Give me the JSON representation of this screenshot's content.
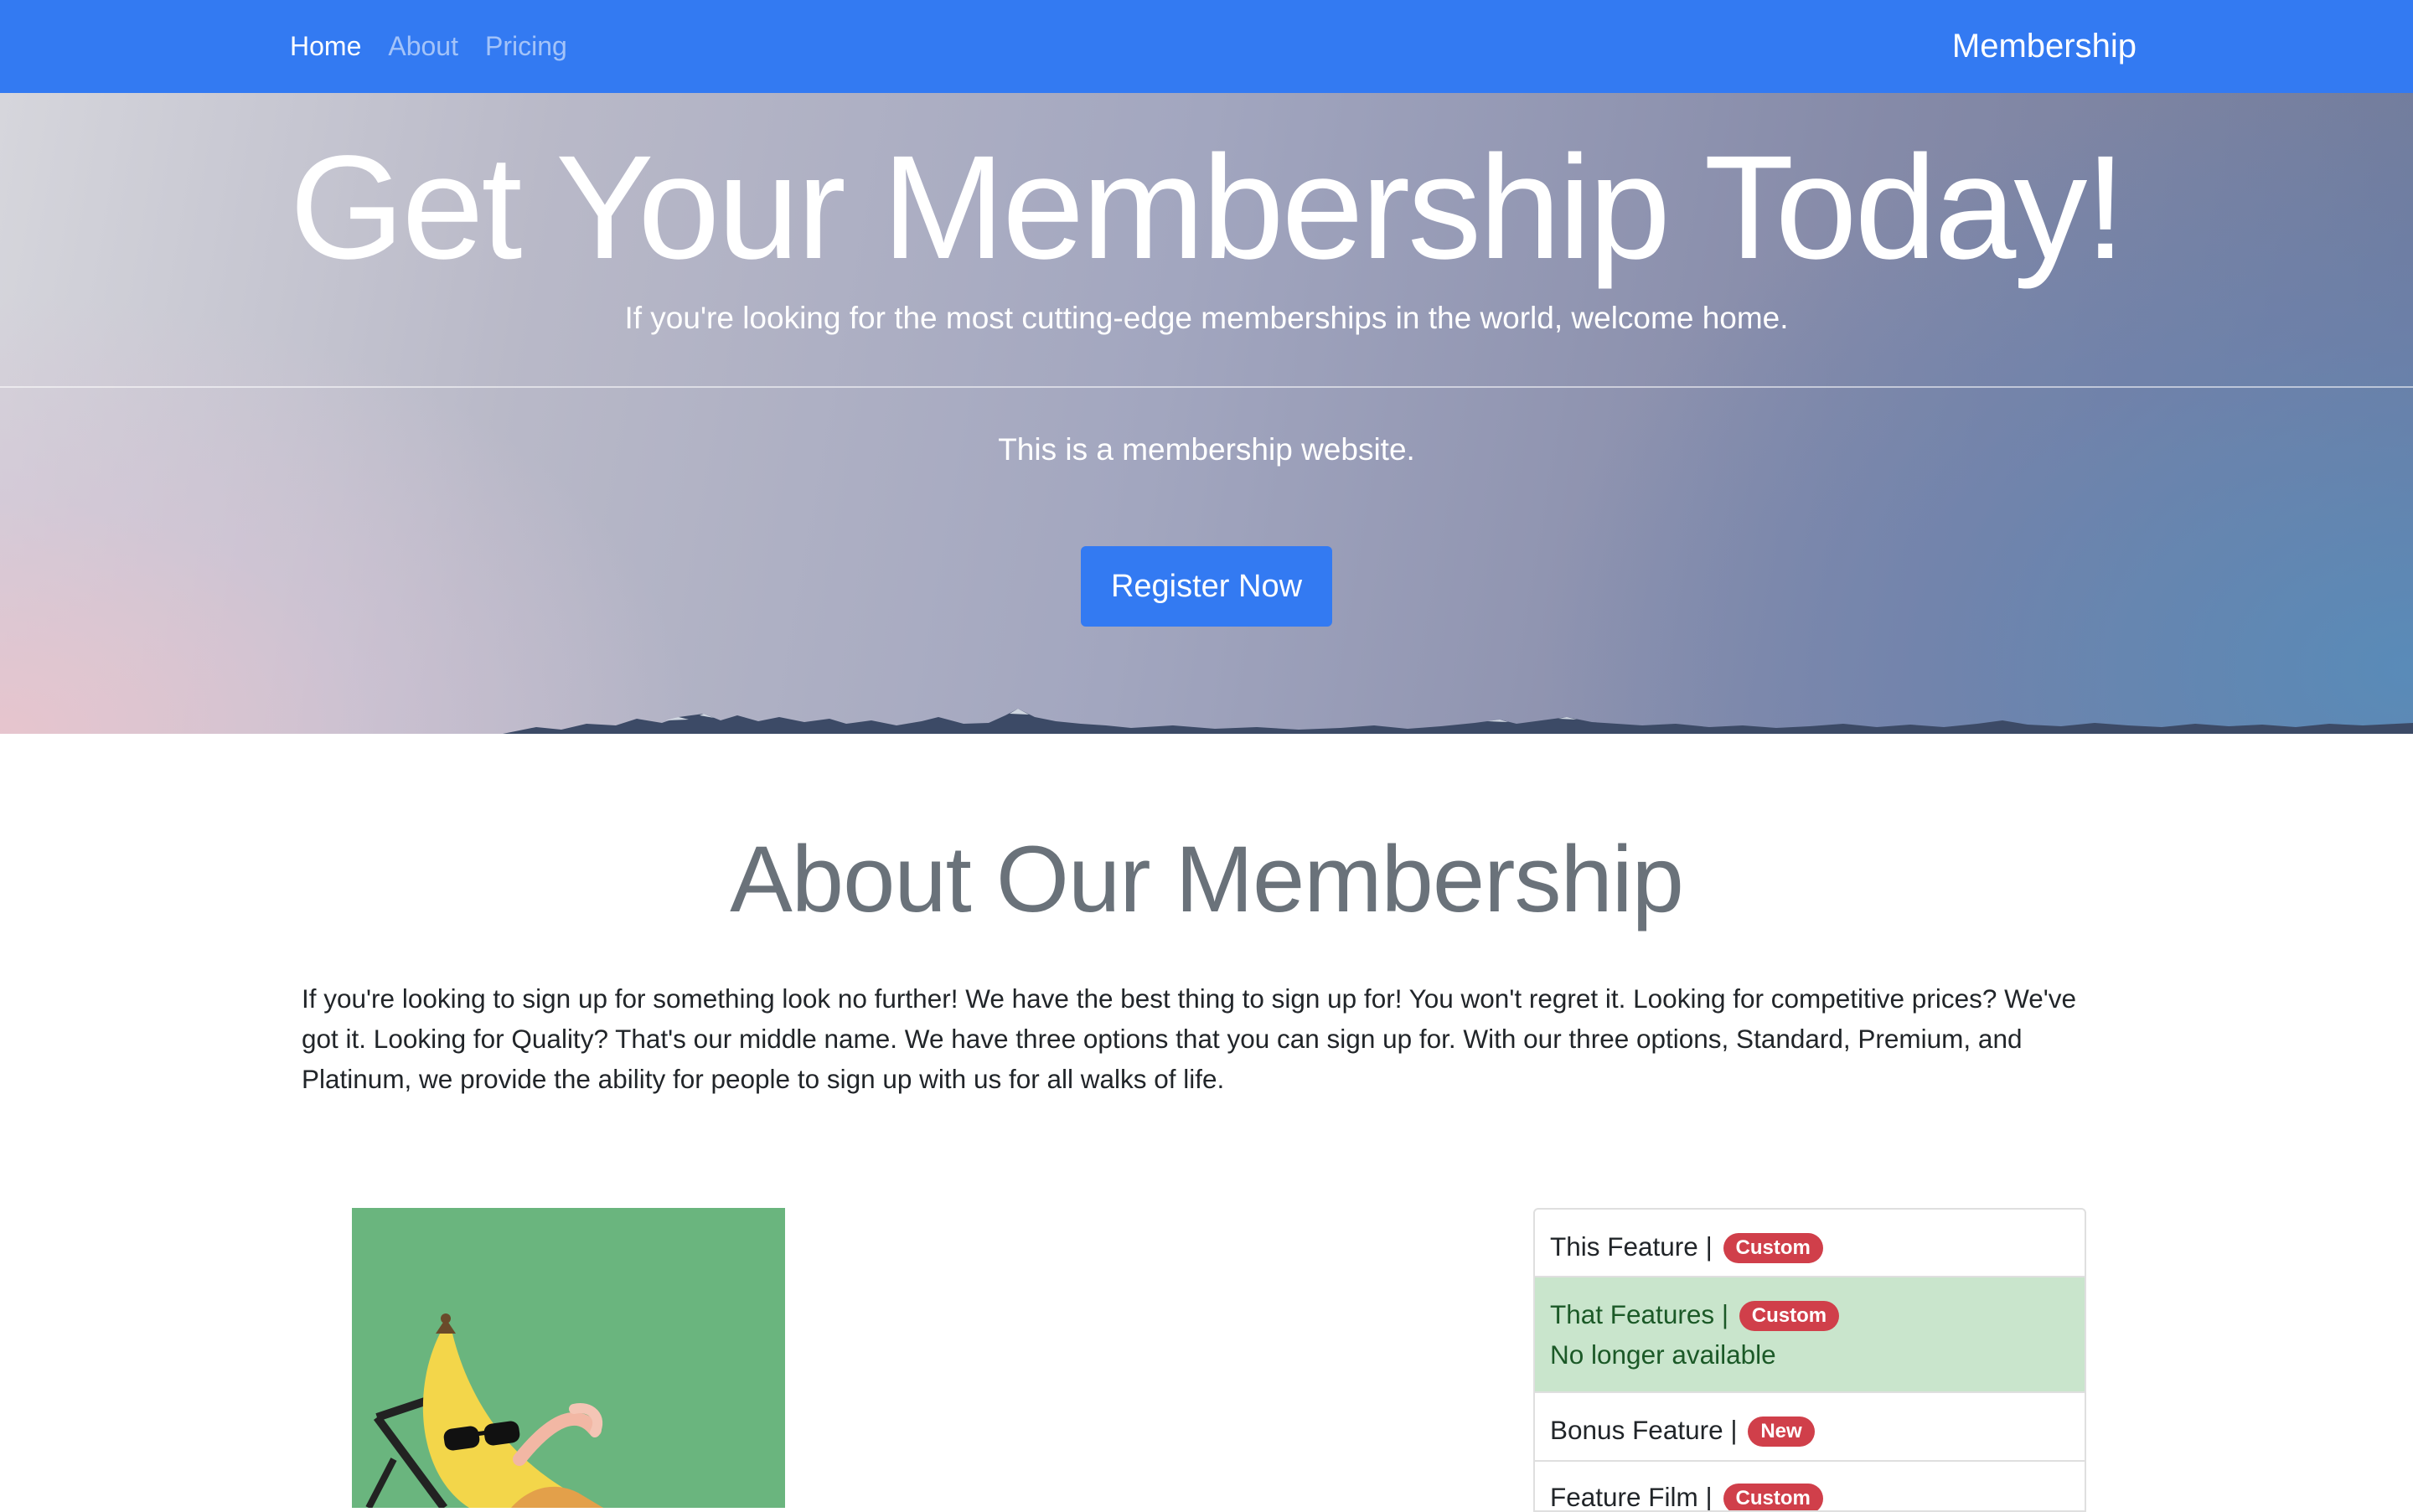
{
  "nav": {
    "links": [
      {
        "label": "Home"
      },
      {
        "label": "About"
      },
      {
        "label": "Pricing"
      }
    ],
    "brand": "Membership"
  },
  "hero": {
    "title": "Get Your Membership Today!",
    "lead": "If you're looking for the most cutting-edge memberships in the world, welcome home.",
    "subtext": "This is a membership website.",
    "cta_label": "Register Now"
  },
  "about": {
    "title": "About Our Membership",
    "text": "If you're looking to sign up for something look no further! We have the best thing to sign up for! You won't regret it. Looking for competitive prices? We've got it. Looking for Quality? That's our middle name. We have three options that you can sign up for. With our three options, Standard, Premium, and Platinum, we provide the ability for people to sign up with us for all walks of life."
  },
  "features": [
    {
      "label": "This Feature |",
      "badge": "Custom"
    },
    {
      "label": "That Features |",
      "badge": "Custom",
      "note": "No longer available"
    },
    {
      "label": "Bonus Feature |",
      "badge": "New"
    },
    {
      "label": "Feature Film |",
      "badge": "Custom"
    }
  ],
  "colors": {
    "navbar": "#337af2",
    "primary_button": "#337af2",
    "badge": "#d03f4a",
    "success_item": "#c9e5cc",
    "image_background": "#6ab57e"
  }
}
